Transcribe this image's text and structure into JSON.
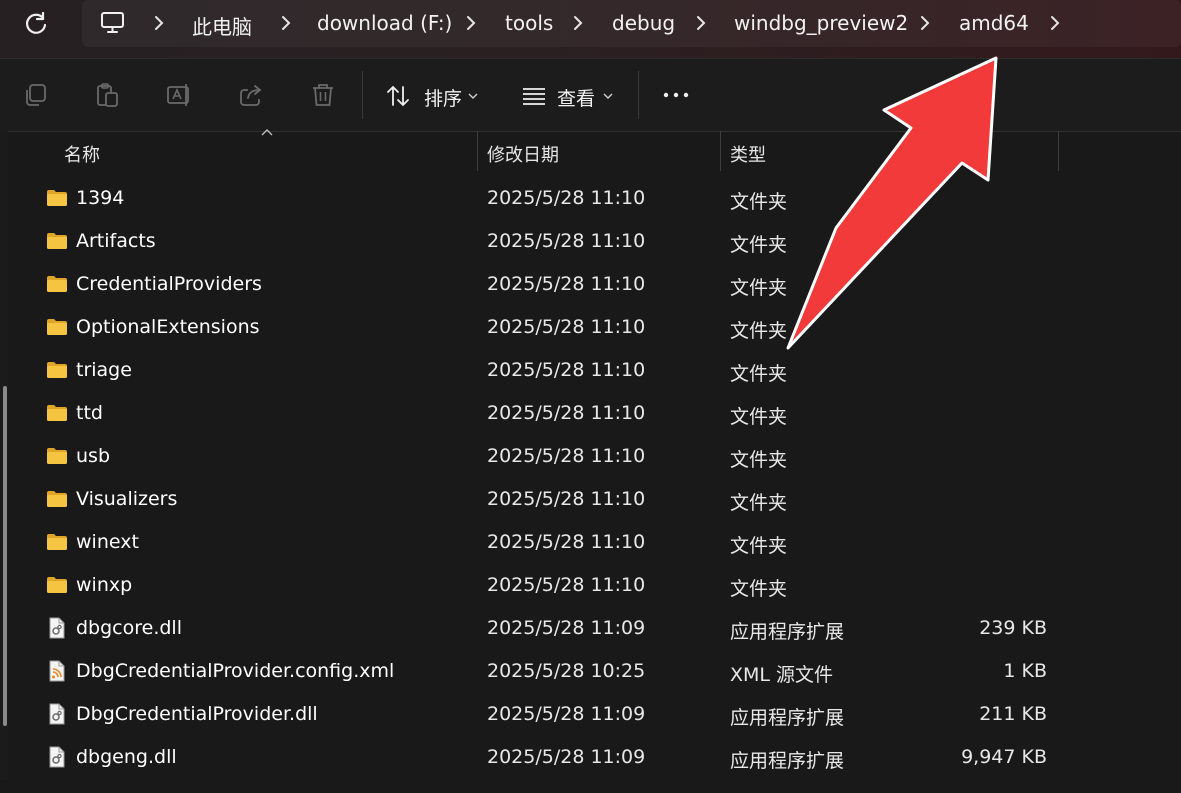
{
  "breadcrumb": {
    "items": [
      "此电脑",
      "download (F:)",
      "tools",
      "debug",
      "windbg_preview2",
      "amd64"
    ]
  },
  "toolbar": {
    "sort_label": "排序",
    "view_label": "查看"
  },
  "columns": {
    "name": "名称",
    "date": "修改日期",
    "type": "类型"
  },
  "files": [
    {
      "name": "1394",
      "date": "2025/5/28 11:10",
      "type": "文件夹",
      "size": "",
      "icon": "folder-icon"
    },
    {
      "name": "Artifacts",
      "date": "2025/5/28 11:10",
      "type": "文件夹",
      "size": "",
      "icon": "folder-icon"
    },
    {
      "name": "CredentialProviders",
      "date": "2025/5/28 11:10",
      "type": "文件夹",
      "size": "",
      "icon": "folder-icon"
    },
    {
      "name": "OptionalExtensions",
      "date": "2025/5/28 11:10",
      "type": "文件夹",
      "size": "",
      "icon": "folder-icon"
    },
    {
      "name": "triage",
      "date": "2025/5/28 11:10",
      "type": "文件夹",
      "size": "",
      "icon": "folder-icon"
    },
    {
      "name": "ttd",
      "date": "2025/5/28 11:10",
      "type": "文件夹",
      "size": "",
      "icon": "folder-icon"
    },
    {
      "name": "usb",
      "date": "2025/5/28 11:10",
      "type": "文件夹",
      "size": "",
      "icon": "folder-icon"
    },
    {
      "name": "Visualizers",
      "date": "2025/5/28 11:10",
      "type": "文件夹",
      "size": "",
      "icon": "folder-icon"
    },
    {
      "name": "winext",
      "date": "2025/5/28 11:10",
      "type": "文件夹",
      "size": "",
      "icon": "folder-icon"
    },
    {
      "name": "winxp",
      "date": "2025/5/28 11:10",
      "type": "文件夹",
      "size": "",
      "icon": "folder-icon"
    },
    {
      "name": "dbgcore.dll",
      "date": "2025/5/28 11:09",
      "type": "应用程序扩展",
      "size": "239 KB",
      "icon": "dll-file-icon"
    },
    {
      "name": "DbgCredentialProvider.config.xml",
      "date": "2025/5/28 10:25",
      "type": "XML 源文件",
      "size": "1 KB",
      "icon": "xml-file-icon"
    },
    {
      "name": "DbgCredentialProvider.dll",
      "date": "2025/5/28 11:09",
      "type": "应用程序扩展",
      "size": "211 KB",
      "icon": "dll-file-icon"
    },
    {
      "name": "dbgeng.dll",
      "date": "2025/5/28 11:09",
      "type": "应用程序扩展",
      "size": "9,947 KB",
      "icon": "dll-file-icon"
    }
  ],
  "colors": {
    "background": "#191919",
    "folder": "#f5c542",
    "arrow": "#f23a3a"
  },
  "icons": [
    "refresh-icon",
    "computer-icon",
    "chevron-right-icon",
    "copy-icon",
    "paste-icon",
    "rename-icon",
    "share-icon",
    "delete-icon",
    "sort-icon",
    "view-icon",
    "more-icon",
    "folder-icon",
    "dll-file-icon",
    "xml-file-icon"
  ]
}
